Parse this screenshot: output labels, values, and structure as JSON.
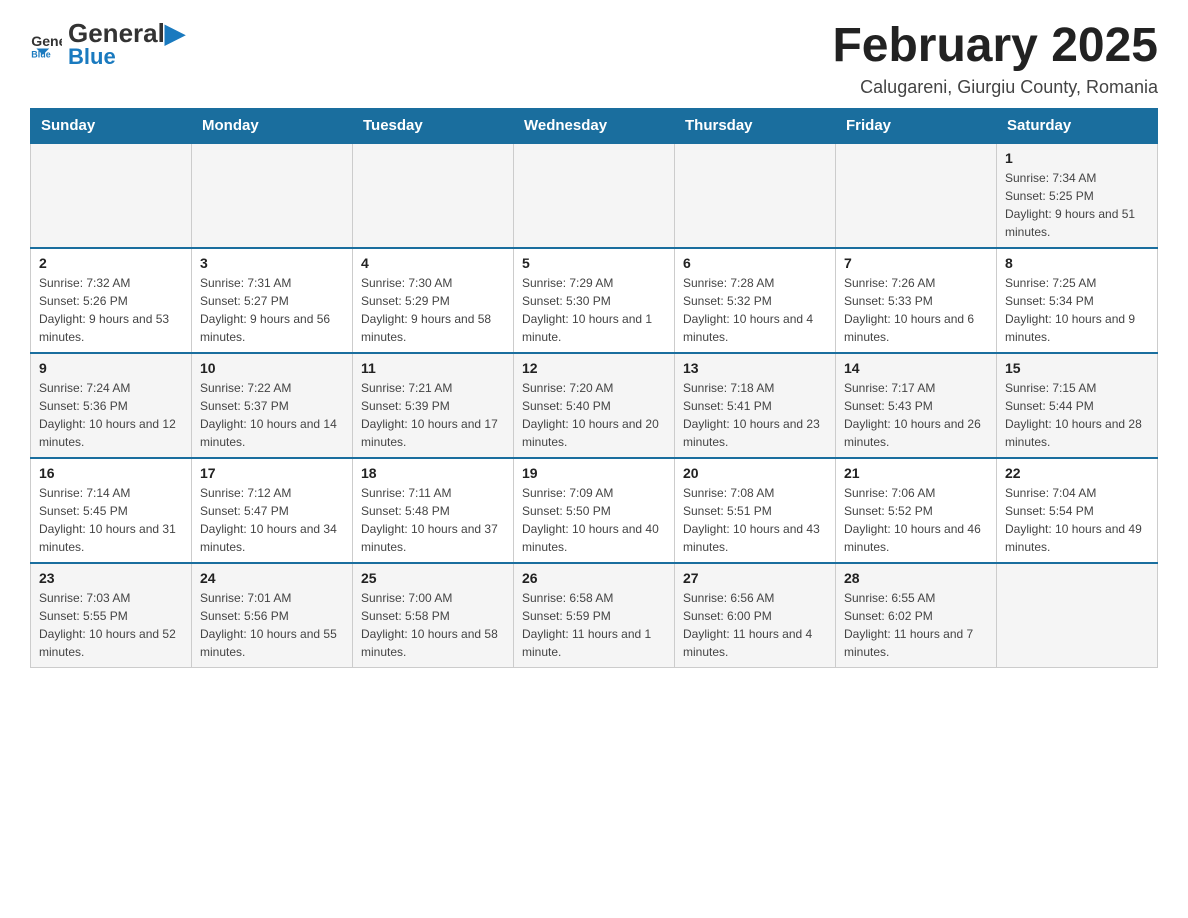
{
  "header": {
    "logo_text_general": "General",
    "logo_text_blue": "Blue",
    "month_title": "February 2025",
    "subtitle": "Calugareni, Giurgiu County, Romania"
  },
  "days_of_week": [
    "Sunday",
    "Monday",
    "Tuesday",
    "Wednesday",
    "Thursday",
    "Friday",
    "Saturday"
  ],
  "weeks": [
    [
      {
        "day": "",
        "info": ""
      },
      {
        "day": "",
        "info": ""
      },
      {
        "day": "",
        "info": ""
      },
      {
        "day": "",
        "info": ""
      },
      {
        "day": "",
        "info": ""
      },
      {
        "day": "",
        "info": ""
      },
      {
        "day": "1",
        "info": "Sunrise: 7:34 AM\nSunset: 5:25 PM\nDaylight: 9 hours and 51 minutes."
      }
    ],
    [
      {
        "day": "2",
        "info": "Sunrise: 7:32 AM\nSunset: 5:26 PM\nDaylight: 9 hours and 53 minutes."
      },
      {
        "day": "3",
        "info": "Sunrise: 7:31 AM\nSunset: 5:27 PM\nDaylight: 9 hours and 56 minutes."
      },
      {
        "day": "4",
        "info": "Sunrise: 7:30 AM\nSunset: 5:29 PM\nDaylight: 9 hours and 58 minutes."
      },
      {
        "day": "5",
        "info": "Sunrise: 7:29 AM\nSunset: 5:30 PM\nDaylight: 10 hours and 1 minute."
      },
      {
        "day": "6",
        "info": "Sunrise: 7:28 AM\nSunset: 5:32 PM\nDaylight: 10 hours and 4 minutes."
      },
      {
        "day": "7",
        "info": "Sunrise: 7:26 AM\nSunset: 5:33 PM\nDaylight: 10 hours and 6 minutes."
      },
      {
        "day": "8",
        "info": "Sunrise: 7:25 AM\nSunset: 5:34 PM\nDaylight: 10 hours and 9 minutes."
      }
    ],
    [
      {
        "day": "9",
        "info": "Sunrise: 7:24 AM\nSunset: 5:36 PM\nDaylight: 10 hours and 12 minutes."
      },
      {
        "day": "10",
        "info": "Sunrise: 7:22 AM\nSunset: 5:37 PM\nDaylight: 10 hours and 14 minutes."
      },
      {
        "day": "11",
        "info": "Sunrise: 7:21 AM\nSunset: 5:39 PM\nDaylight: 10 hours and 17 minutes."
      },
      {
        "day": "12",
        "info": "Sunrise: 7:20 AM\nSunset: 5:40 PM\nDaylight: 10 hours and 20 minutes."
      },
      {
        "day": "13",
        "info": "Sunrise: 7:18 AM\nSunset: 5:41 PM\nDaylight: 10 hours and 23 minutes."
      },
      {
        "day": "14",
        "info": "Sunrise: 7:17 AM\nSunset: 5:43 PM\nDaylight: 10 hours and 26 minutes."
      },
      {
        "day": "15",
        "info": "Sunrise: 7:15 AM\nSunset: 5:44 PM\nDaylight: 10 hours and 28 minutes."
      }
    ],
    [
      {
        "day": "16",
        "info": "Sunrise: 7:14 AM\nSunset: 5:45 PM\nDaylight: 10 hours and 31 minutes."
      },
      {
        "day": "17",
        "info": "Sunrise: 7:12 AM\nSunset: 5:47 PM\nDaylight: 10 hours and 34 minutes."
      },
      {
        "day": "18",
        "info": "Sunrise: 7:11 AM\nSunset: 5:48 PM\nDaylight: 10 hours and 37 minutes."
      },
      {
        "day": "19",
        "info": "Sunrise: 7:09 AM\nSunset: 5:50 PM\nDaylight: 10 hours and 40 minutes."
      },
      {
        "day": "20",
        "info": "Sunrise: 7:08 AM\nSunset: 5:51 PM\nDaylight: 10 hours and 43 minutes."
      },
      {
        "day": "21",
        "info": "Sunrise: 7:06 AM\nSunset: 5:52 PM\nDaylight: 10 hours and 46 minutes."
      },
      {
        "day": "22",
        "info": "Sunrise: 7:04 AM\nSunset: 5:54 PM\nDaylight: 10 hours and 49 minutes."
      }
    ],
    [
      {
        "day": "23",
        "info": "Sunrise: 7:03 AM\nSunset: 5:55 PM\nDaylight: 10 hours and 52 minutes."
      },
      {
        "day": "24",
        "info": "Sunrise: 7:01 AM\nSunset: 5:56 PM\nDaylight: 10 hours and 55 minutes."
      },
      {
        "day": "25",
        "info": "Sunrise: 7:00 AM\nSunset: 5:58 PM\nDaylight: 10 hours and 58 minutes."
      },
      {
        "day": "26",
        "info": "Sunrise: 6:58 AM\nSunset: 5:59 PM\nDaylight: 11 hours and 1 minute."
      },
      {
        "day": "27",
        "info": "Sunrise: 6:56 AM\nSunset: 6:00 PM\nDaylight: 11 hours and 4 minutes."
      },
      {
        "day": "28",
        "info": "Sunrise: 6:55 AM\nSunset: 6:02 PM\nDaylight: 11 hours and 7 minutes."
      },
      {
        "day": "",
        "info": ""
      }
    ]
  ]
}
